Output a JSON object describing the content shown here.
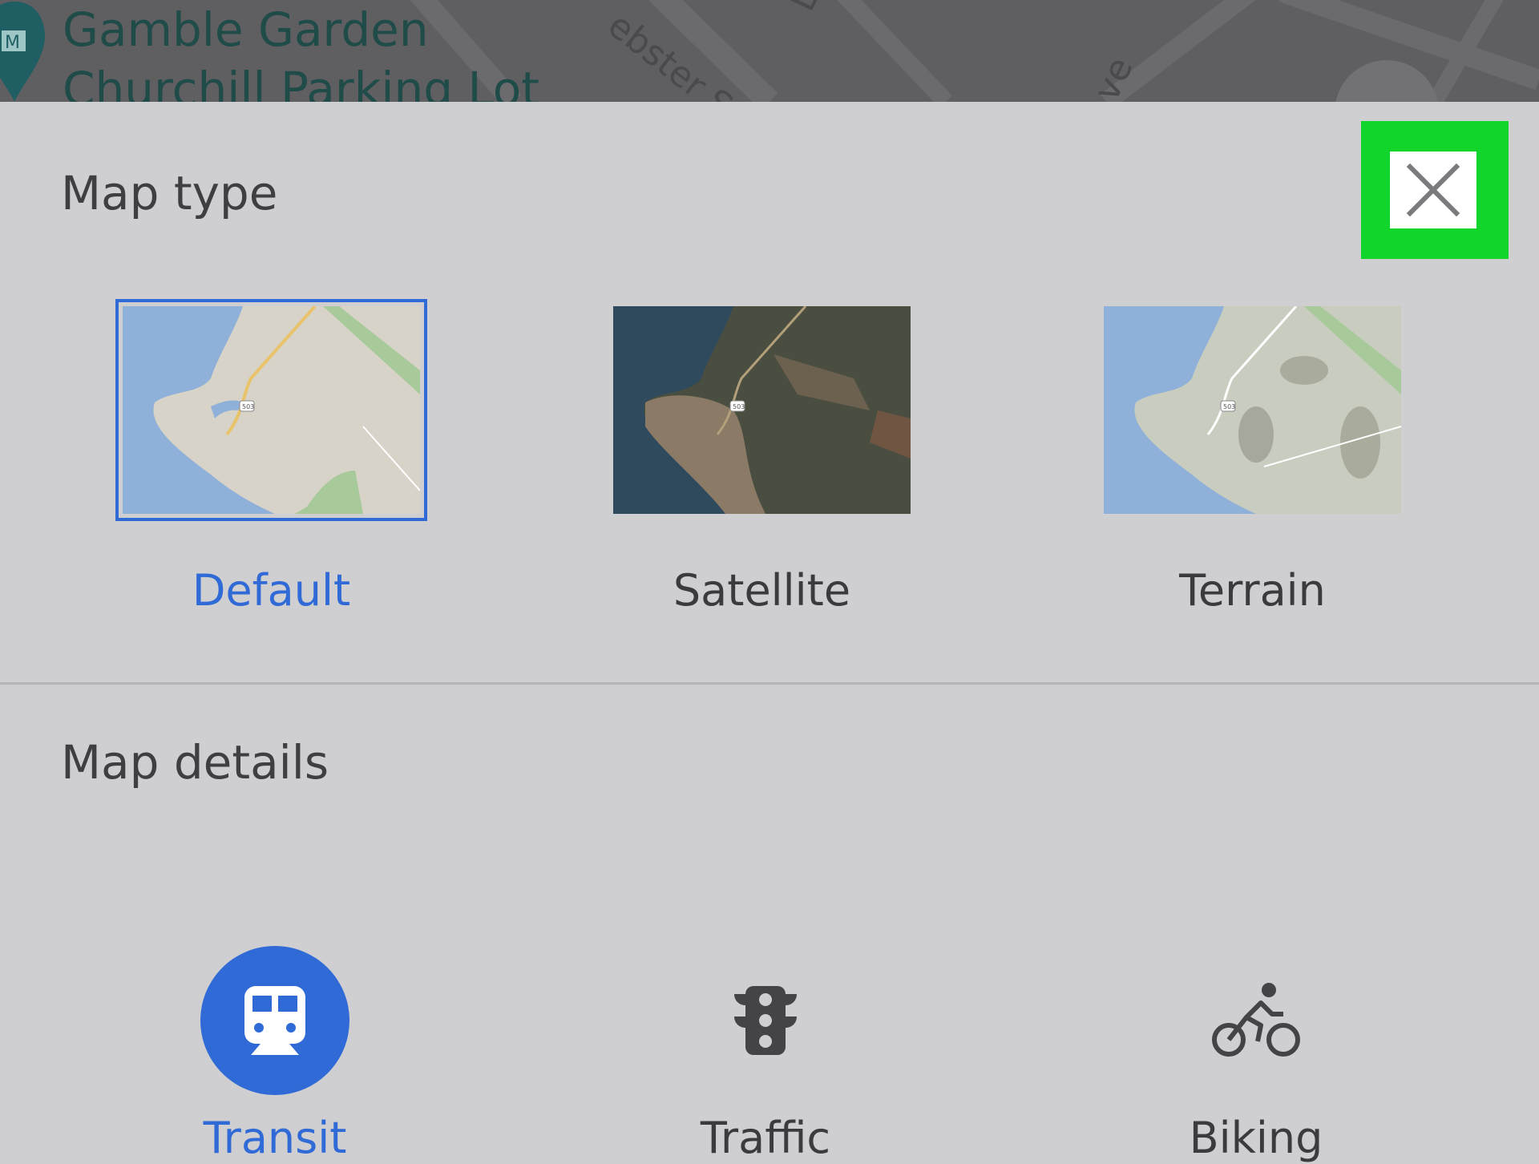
{
  "background_map": {
    "poi_icon": "museum-pin-icon",
    "poi_name": "Gamble Garden",
    "poi_secondary": "Churchill Parking Lot",
    "streets": [
      "ebster St",
      "Low",
      "ve"
    ]
  },
  "map_type": {
    "title": "Map type",
    "close_icon": "close-icon",
    "options": [
      {
        "label": "Default",
        "selected": true,
        "thumbnail": "default-map-thumbnail"
      },
      {
        "label": "Satellite",
        "selected": false,
        "thumbnail": "satellite-map-thumbnail"
      },
      {
        "label": "Terrain",
        "selected": false,
        "thumbnail": "terrain-map-thumbnail"
      }
    ]
  },
  "map_details": {
    "title": "Map details",
    "options": [
      {
        "label": "Transit",
        "active": true,
        "icon": "train-icon"
      },
      {
        "label": "Traffic",
        "active": false,
        "icon": "traffic-light-icon"
      },
      {
        "label": "Biking",
        "active": false,
        "icon": "bicycle-icon"
      }
    ]
  },
  "colors": {
    "accent": "#2f6ad6",
    "highlight": "#11d52b",
    "sheet_background": "#cfced1",
    "text": "#3b3b3e"
  }
}
